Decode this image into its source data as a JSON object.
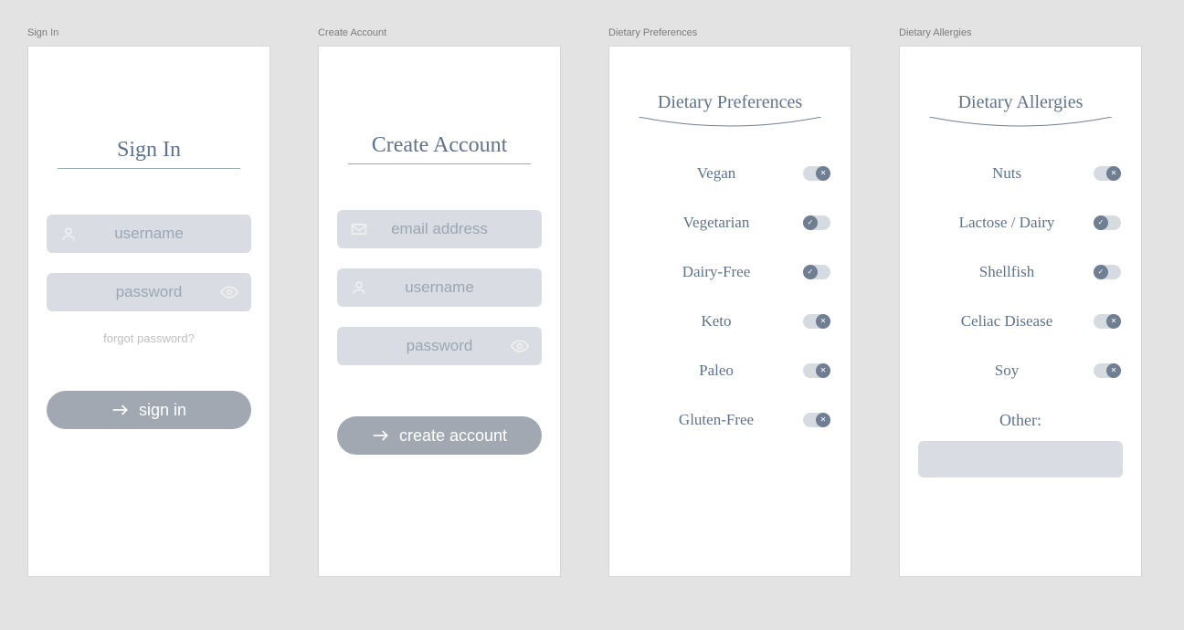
{
  "screens": {
    "signin": {
      "label": "Sign In",
      "title": "Sign In",
      "username_placeholder": "username",
      "password_placeholder": "password",
      "forgot": "forgot password?",
      "button": "sign in"
    },
    "create": {
      "label": "Create  Account",
      "title": "Create Account",
      "email_placeholder": "email address",
      "username_placeholder": "username",
      "password_placeholder": "password",
      "button": "create account"
    },
    "prefs": {
      "label": "Dietary Preferences",
      "title": "Dietary Preferences",
      "items": [
        {
          "label": "Vegan",
          "on": false
        },
        {
          "label": "Vegetarian",
          "on": true
        },
        {
          "label": "Dairy-Free",
          "on": true
        },
        {
          "label": "Keto",
          "on": false
        },
        {
          "label": "Paleo",
          "on": false
        },
        {
          "label": "Gluten-Free",
          "on": false
        }
      ]
    },
    "allerg": {
      "label": "Dietary Allergies",
      "title": "Dietary Allergies",
      "items": [
        {
          "label": "Nuts",
          "on": false
        },
        {
          "label": "Lactose / Dairy",
          "on": true
        },
        {
          "label": "Shellfish",
          "on": true
        },
        {
          "label": "Celiac Disease",
          "on": false
        },
        {
          "label": "Soy",
          "on": false
        }
      ],
      "other_label": "Other:"
    }
  }
}
